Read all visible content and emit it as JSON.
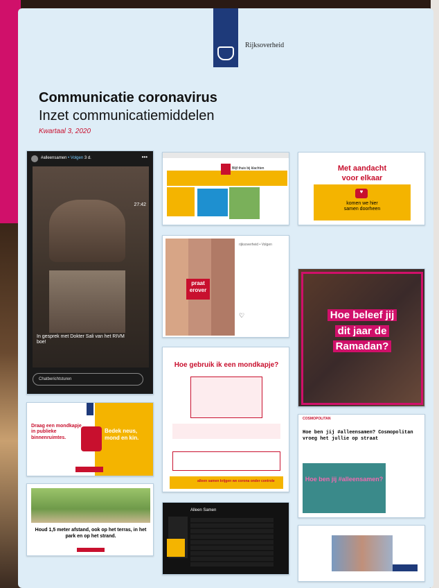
{
  "header": {
    "brand": "Rijksoverheid",
    "title": "Communicatie coronavirus",
    "subtitle": "Inzet communicatiemiddelen",
    "quarter": "Kwartaal 3, 2020"
  },
  "story": {
    "tag": "#alleensamen",
    "follow": "• Volgen",
    "age": "3 d.",
    "time": "27:42",
    "caption": "In gesprek met Dokter Sali van het RIVM boe!",
    "reply_placeholder": "Chatberichtsturen"
  },
  "map_card": {
    "label": "Blijf thuis bij klachten"
  },
  "aandacht": {
    "line1": "Met aandacht",
    "line2": "voor elkaar",
    "line3": "komen we hier",
    "line4": "samen doorheen"
  },
  "praat": {
    "tag1": "praat",
    "tag2": "erover"
  },
  "ramadan": {
    "line1": "Hoe beleef jij",
    "line2": "dit jaar de",
    "line3": "Ramadan?"
  },
  "mondkapje": {
    "title": "Hoe gebruik ik een mondkapje?",
    "footer": "alleen samen krijgen we corona onder controle"
  },
  "draag": {
    "left": "Draag een mondkapje in publieke binnenruimtes.",
    "right": "Bedek neus, mond en kin."
  },
  "cosmo": {
    "brand": "COSMOPOLITAN",
    "headline": "Hoe ben jij #alleensamen? Cosmopolitan vroeg het jullie op straat",
    "video_text": "Hoe ben jij #alleensamen?"
  },
  "afstand": {
    "text": "Houd 1,5 meter afstand, ook op het terras, in het park en op het strand."
  },
  "spotify": {
    "title": "Alleen Samen"
  },
  "colors": {
    "accent": "#f4b400",
    "brand": "#1e3a7a",
    "red": "#c8102e",
    "pink": "#d0106a"
  }
}
